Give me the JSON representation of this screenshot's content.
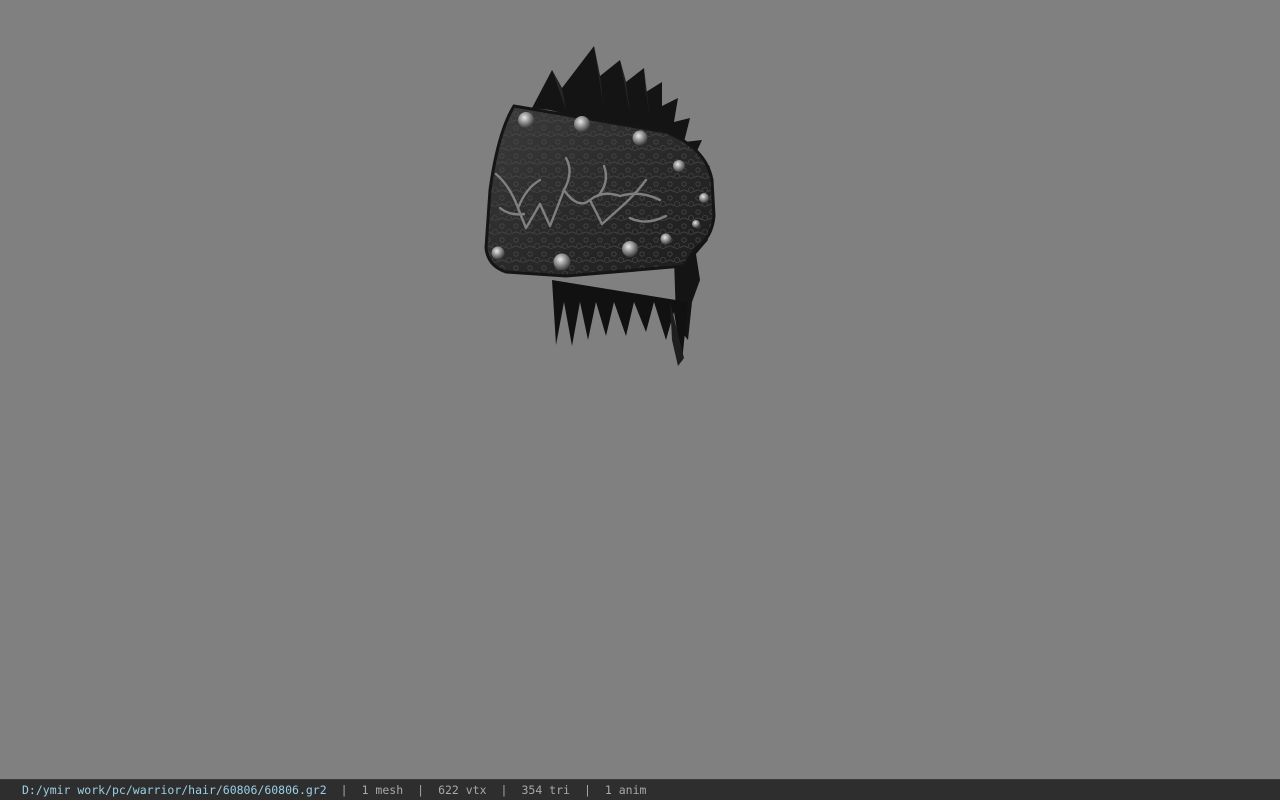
{
  "viewport": {
    "background_color": "#808080",
    "model_icon": "spiked-helmet-model"
  },
  "statusbar": {
    "file_path": "D:/ymir work/pc/warrior/hair/60806/60806.gr2",
    "separator": "|",
    "mesh_count": "1 mesh",
    "vertex_count": "622 vtx",
    "triangle_count": "354 tri",
    "anim_count": "1 anim",
    "path_color": "#9ccfe6",
    "text_color": "#a8a8a8",
    "background_color": "#2e2e2e"
  }
}
